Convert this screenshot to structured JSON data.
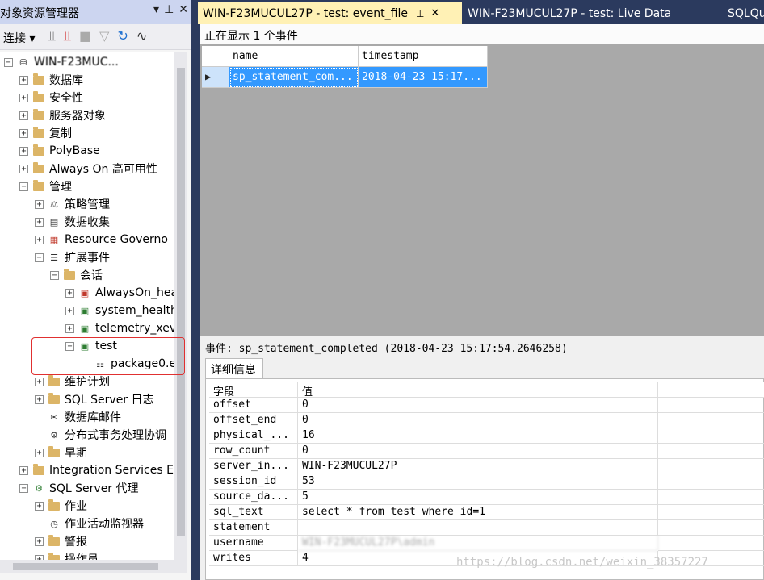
{
  "explorer": {
    "title": "对象资源管理器",
    "title_buttons": [
      "▾",
      "⊥",
      "✕"
    ],
    "toolbar": {
      "connect_label": "连接",
      "connect_arrow": "▾"
    },
    "tree": [
      {
        "label": "WIN-F23MUC...",
        "indent": 0,
        "expander": "⊟",
        "icon": "server-icon"
      },
      {
        "label": "数据库",
        "indent": 1,
        "expander": "⊞",
        "icon": "folder"
      },
      {
        "label": "安全性",
        "indent": 1,
        "expander": "⊞",
        "icon": "folder"
      },
      {
        "label": "服务器对象",
        "indent": 1,
        "expander": "⊞",
        "icon": "folder"
      },
      {
        "label": "复制",
        "indent": 1,
        "expander": "⊞",
        "icon": "folder"
      },
      {
        "label": "PolyBase",
        "indent": 1,
        "expander": "⊞",
        "icon": "folder"
      },
      {
        "label": "Always On 高可用性",
        "indent": 1,
        "expander": "⊞",
        "icon": "folder"
      },
      {
        "label": "管理",
        "indent": 1,
        "expander": "⊟",
        "icon": "folder"
      },
      {
        "label": "策略管理",
        "indent": 2,
        "expander": "⊞",
        "icon": "policy-icon"
      },
      {
        "label": "数据收集",
        "indent": 2,
        "expander": "⊞",
        "icon": "data-collection-icon"
      },
      {
        "label": "Resource Governo",
        "indent": 2,
        "expander": "⊞",
        "icon": "resource-governor-icon"
      },
      {
        "label": "扩展事件",
        "indent": 2,
        "expander": "⊟",
        "icon": "extended-events-icon"
      },
      {
        "label": "会话",
        "indent": 3,
        "expander": "⊟",
        "icon": "folder"
      },
      {
        "label": "AlwaysOn_hea",
        "indent": 4,
        "expander": "⊞",
        "icon": "session-stopped-icon"
      },
      {
        "label": "system_health",
        "indent": 4,
        "expander": "⊞",
        "icon": "session-running-icon"
      },
      {
        "label": "telemetry_xev",
        "indent": 4,
        "expander": "⊞",
        "icon": "session-running-icon"
      },
      {
        "label": "test",
        "indent": 4,
        "expander": "⊟",
        "icon": "session-running-icon"
      },
      {
        "label": "package0.e",
        "indent": 5,
        "expander": "",
        "icon": "event-file-icon"
      },
      {
        "label": "维护计划",
        "indent": 2,
        "expander": "⊞",
        "icon": "folder"
      },
      {
        "label": "SQL Server 日志",
        "indent": 2,
        "expander": "⊞",
        "icon": "folder"
      },
      {
        "label": "数据库邮件",
        "indent": 2,
        "expander": "",
        "icon": "database-mail-icon"
      },
      {
        "label": "分布式事务处理协调",
        "indent": 2,
        "expander": "",
        "icon": "dtc-icon"
      },
      {
        "label": "早期",
        "indent": 2,
        "expander": "⊞",
        "icon": "folder"
      },
      {
        "label": "Integration Services E",
        "indent": 1,
        "expander": "⊞",
        "icon": "folder"
      },
      {
        "label": "SQL Server 代理",
        "indent": 1,
        "expander": "⊟",
        "icon": "sql-agent-icon"
      },
      {
        "label": "作业",
        "indent": 2,
        "expander": "⊞",
        "icon": "folder"
      },
      {
        "label": "作业活动监视器",
        "indent": 2,
        "expander": "",
        "icon": "job-monitor-icon"
      },
      {
        "label": "警报",
        "indent": 2,
        "expander": "⊞",
        "icon": "folder"
      },
      {
        "label": "操作员",
        "indent": 2,
        "expander": "⊞",
        "icon": "folder"
      }
    ]
  },
  "tabs": {
    "active": {
      "label": "WIN-F23MUCUL27P - test: event_file",
      "pin": "⊥",
      "close": "✕"
    },
    "second": {
      "label": "WIN-F23MUCUL27P - test: Live Data"
    },
    "third": {
      "label": "SQLQu"
    }
  },
  "viewer": {
    "status_text": "正在显示 1 个事件",
    "grid": {
      "columns": [
        "name",
        "timestamp"
      ],
      "rows": [
        {
          "name": "sp_statement_com...",
          "timestamp": "2018-04-23 15:17..."
        }
      ],
      "row_marker": "▶"
    },
    "event_line": "事件: sp_statement_completed (2018-04-23 15:17:54.2646258)",
    "detail_tab": "详细信息",
    "details": {
      "columns": [
        "字段",
        "值"
      ],
      "rows": [
        {
          "field": "offset",
          "value": "0"
        },
        {
          "field": "offset_end",
          "value": "0"
        },
        {
          "field": "physical_...",
          "value": "16"
        },
        {
          "field": "row_count",
          "value": "0"
        },
        {
          "field": "server_in...",
          "value": "WIN-F23MUCUL27P"
        },
        {
          "field": "session_id",
          "value": "53"
        },
        {
          "field": "source_da...",
          "value": "5"
        },
        {
          "field": "sql_text",
          "value": "select * from test where id=1"
        },
        {
          "field": "statement",
          "value": ""
        },
        {
          "field": "username",
          "value": "WIN-F23MUCUL27P\\admin"
        },
        {
          "field": "writes",
          "value": "4"
        }
      ]
    }
  },
  "watermark": "https://blog.csdn.net/weixin_38357227"
}
